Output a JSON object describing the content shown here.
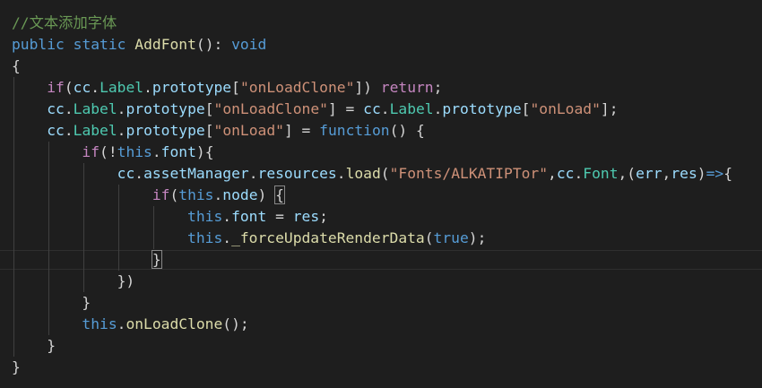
{
  "editor": {
    "lines": [
      [
        {
          "t": "//文本添加字体",
          "c": "comment"
        }
      ],
      [
        {
          "t": "public",
          "c": "keyword"
        },
        {
          "t": " ",
          "c": "plain"
        },
        {
          "t": "static",
          "c": "keyword"
        },
        {
          "t": " ",
          "c": "plain"
        },
        {
          "t": "AddFont",
          "c": "func"
        },
        {
          "t": "(): ",
          "c": "plain"
        },
        {
          "t": "void",
          "c": "keyword"
        }
      ],
      [
        {
          "t": "{",
          "c": "plain"
        }
      ],
      [
        {
          "t": "    ",
          "c": "plain"
        },
        {
          "t": "if",
          "c": "control"
        },
        {
          "t": "(",
          "c": "plain"
        },
        {
          "t": "cc",
          "c": "var"
        },
        {
          "t": ".",
          "c": "plain"
        },
        {
          "t": "Label",
          "c": "type"
        },
        {
          "t": ".",
          "c": "plain"
        },
        {
          "t": "prototype",
          "c": "var"
        },
        {
          "t": "[",
          "c": "plain"
        },
        {
          "t": "\"onLoadClone\"",
          "c": "string"
        },
        {
          "t": "]) ",
          "c": "plain"
        },
        {
          "t": "return",
          "c": "control"
        },
        {
          "t": ";",
          "c": "plain"
        }
      ],
      [
        {
          "t": "    ",
          "c": "plain"
        },
        {
          "t": "cc",
          "c": "var"
        },
        {
          "t": ".",
          "c": "plain"
        },
        {
          "t": "Label",
          "c": "type"
        },
        {
          "t": ".",
          "c": "plain"
        },
        {
          "t": "prototype",
          "c": "var"
        },
        {
          "t": "[",
          "c": "plain"
        },
        {
          "t": "\"onLoadClone\"",
          "c": "string"
        },
        {
          "t": "] = ",
          "c": "plain"
        },
        {
          "t": "cc",
          "c": "var"
        },
        {
          "t": ".",
          "c": "plain"
        },
        {
          "t": "Label",
          "c": "type"
        },
        {
          "t": ".",
          "c": "plain"
        },
        {
          "t": "prototype",
          "c": "var"
        },
        {
          "t": "[",
          "c": "plain"
        },
        {
          "t": "\"onLoad\"",
          "c": "string"
        },
        {
          "t": "];",
          "c": "plain"
        }
      ],
      [
        {
          "t": "    ",
          "c": "plain"
        },
        {
          "t": "cc",
          "c": "var"
        },
        {
          "t": ".",
          "c": "plain"
        },
        {
          "t": "Label",
          "c": "type"
        },
        {
          "t": ".",
          "c": "plain"
        },
        {
          "t": "prototype",
          "c": "var"
        },
        {
          "t": "[",
          "c": "plain"
        },
        {
          "t": "\"onLoad\"",
          "c": "string"
        },
        {
          "t": "] = ",
          "c": "plain"
        },
        {
          "t": "function",
          "c": "keyword"
        },
        {
          "t": "() {",
          "c": "plain"
        }
      ],
      [
        {
          "t": "        ",
          "c": "plain"
        },
        {
          "t": "if",
          "c": "control"
        },
        {
          "t": "(!",
          "c": "plain"
        },
        {
          "t": "this",
          "c": "keyword"
        },
        {
          "t": ".",
          "c": "plain"
        },
        {
          "t": "font",
          "c": "var"
        },
        {
          "t": "){",
          "c": "plain"
        }
      ],
      [
        {
          "t": "            ",
          "c": "plain"
        },
        {
          "t": "cc",
          "c": "var"
        },
        {
          "t": ".",
          "c": "plain"
        },
        {
          "t": "assetManager",
          "c": "var"
        },
        {
          "t": ".",
          "c": "plain"
        },
        {
          "t": "resources",
          "c": "var"
        },
        {
          "t": ".",
          "c": "plain"
        },
        {
          "t": "load",
          "c": "func"
        },
        {
          "t": "(",
          "c": "plain"
        },
        {
          "t": "\"Fonts/ALKATIPTor\"",
          "c": "string"
        },
        {
          "t": ",",
          "c": "plain"
        },
        {
          "t": "cc",
          "c": "var"
        },
        {
          "t": ".",
          "c": "plain"
        },
        {
          "t": "Font",
          "c": "type"
        },
        {
          "t": ",(",
          "c": "plain"
        },
        {
          "t": "err",
          "c": "var"
        },
        {
          "t": ",",
          "c": "plain"
        },
        {
          "t": "res",
          "c": "var"
        },
        {
          "t": ")",
          "c": "plain"
        },
        {
          "t": "=>",
          "c": "keyword"
        },
        {
          "t": "{",
          "c": "plain"
        }
      ],
      [
        {
          "t": "                ",
          "c": "plain"
        },
        {
          "t": "if",
          "c": "control"
        },
        {
          "t": "(",
          "c": "plain"
        },
        {
          "t": "this",
          "c": "keyword"
        },
        {
          "t": ".",
          "c": "plain"
        },
        {
          "t": "node",
          "c": "var"
        },
        {
          "t": ") ",
          "c": "plain"
        },
        {
          "t": "{",
          "c": "bracket-match"
        }
      ],
      [
        {
          "t": "                    ",
          "c": "plain"
        },
        {
          "t": "this",
          "c": "keyword"
        },
        {
          "t": ".",
          "c": "plain"
        },
        {
          "t": "font",
          "c": "var"
        },
        {
          "t": " = ",
          "c": "plain"
        },
        {
          "t": "res",
          "c": "var"
        },
        {
          "t": ";",
          "c": "plain"
        }
      ],
      [
        {
          "t": "                    ",
          "c": "plain"
        },
        {
          "t": "this",
          "c": "keyword"
        },
        {
          "t": ".",
          "c": "plain"
        },
        {
          "t": "_forceUpdateRenderData",
          "c": "func"
        },
        {
          "t": "(",
          "c": "plain"
        },
        {
          "t": "true",
          "c": "keyword"
        },
        {
          "t": ");",
          "c": "plain"
        }
      ],
      [
        {
          "t": "                ",
          "c": "plain"
        },
        {
          "t": "}",
          "c": "bracket-match"
        }
      ],
      [
        {
          "t": "            })",
          "c": "plain"
        }
      ],
      [
        {
          "t": "        }",
          "c": "plain"
        }
      ],
      [
        {
          "t": "        ",
          "c": "plain"
        },
        {
          "t": "this",
          "c": "keyword"
        },
        {
          "t": ".",
          "c": "plain"
        },
        {
          "t": "onLoadClone",
          "c": "func"
        },
        {
          "t": "();",
          "c": "plain"
        }
      ],
      [
        {
          "t": "    }",
          "c": "plain"
        }
      ],
      [
        {
          "t": "}",
          "c": "plain"
        }
      ]
    ]
  },
  "colors": {
    "background": "#1e1e1e",
    "plain": "#d4d4d4",
    "comment": "#6a9955",
    "keyword": "#569cd6",
    "control": "#c586c0",
    "func": "#dcdcaa",
    "type": "#4ec9b0",
    "var": "#9cdcfe",
    "string": "#ce9178",
    "bracket-match": "#d4d4d4",
    "guide": "#404040"
  }
}
